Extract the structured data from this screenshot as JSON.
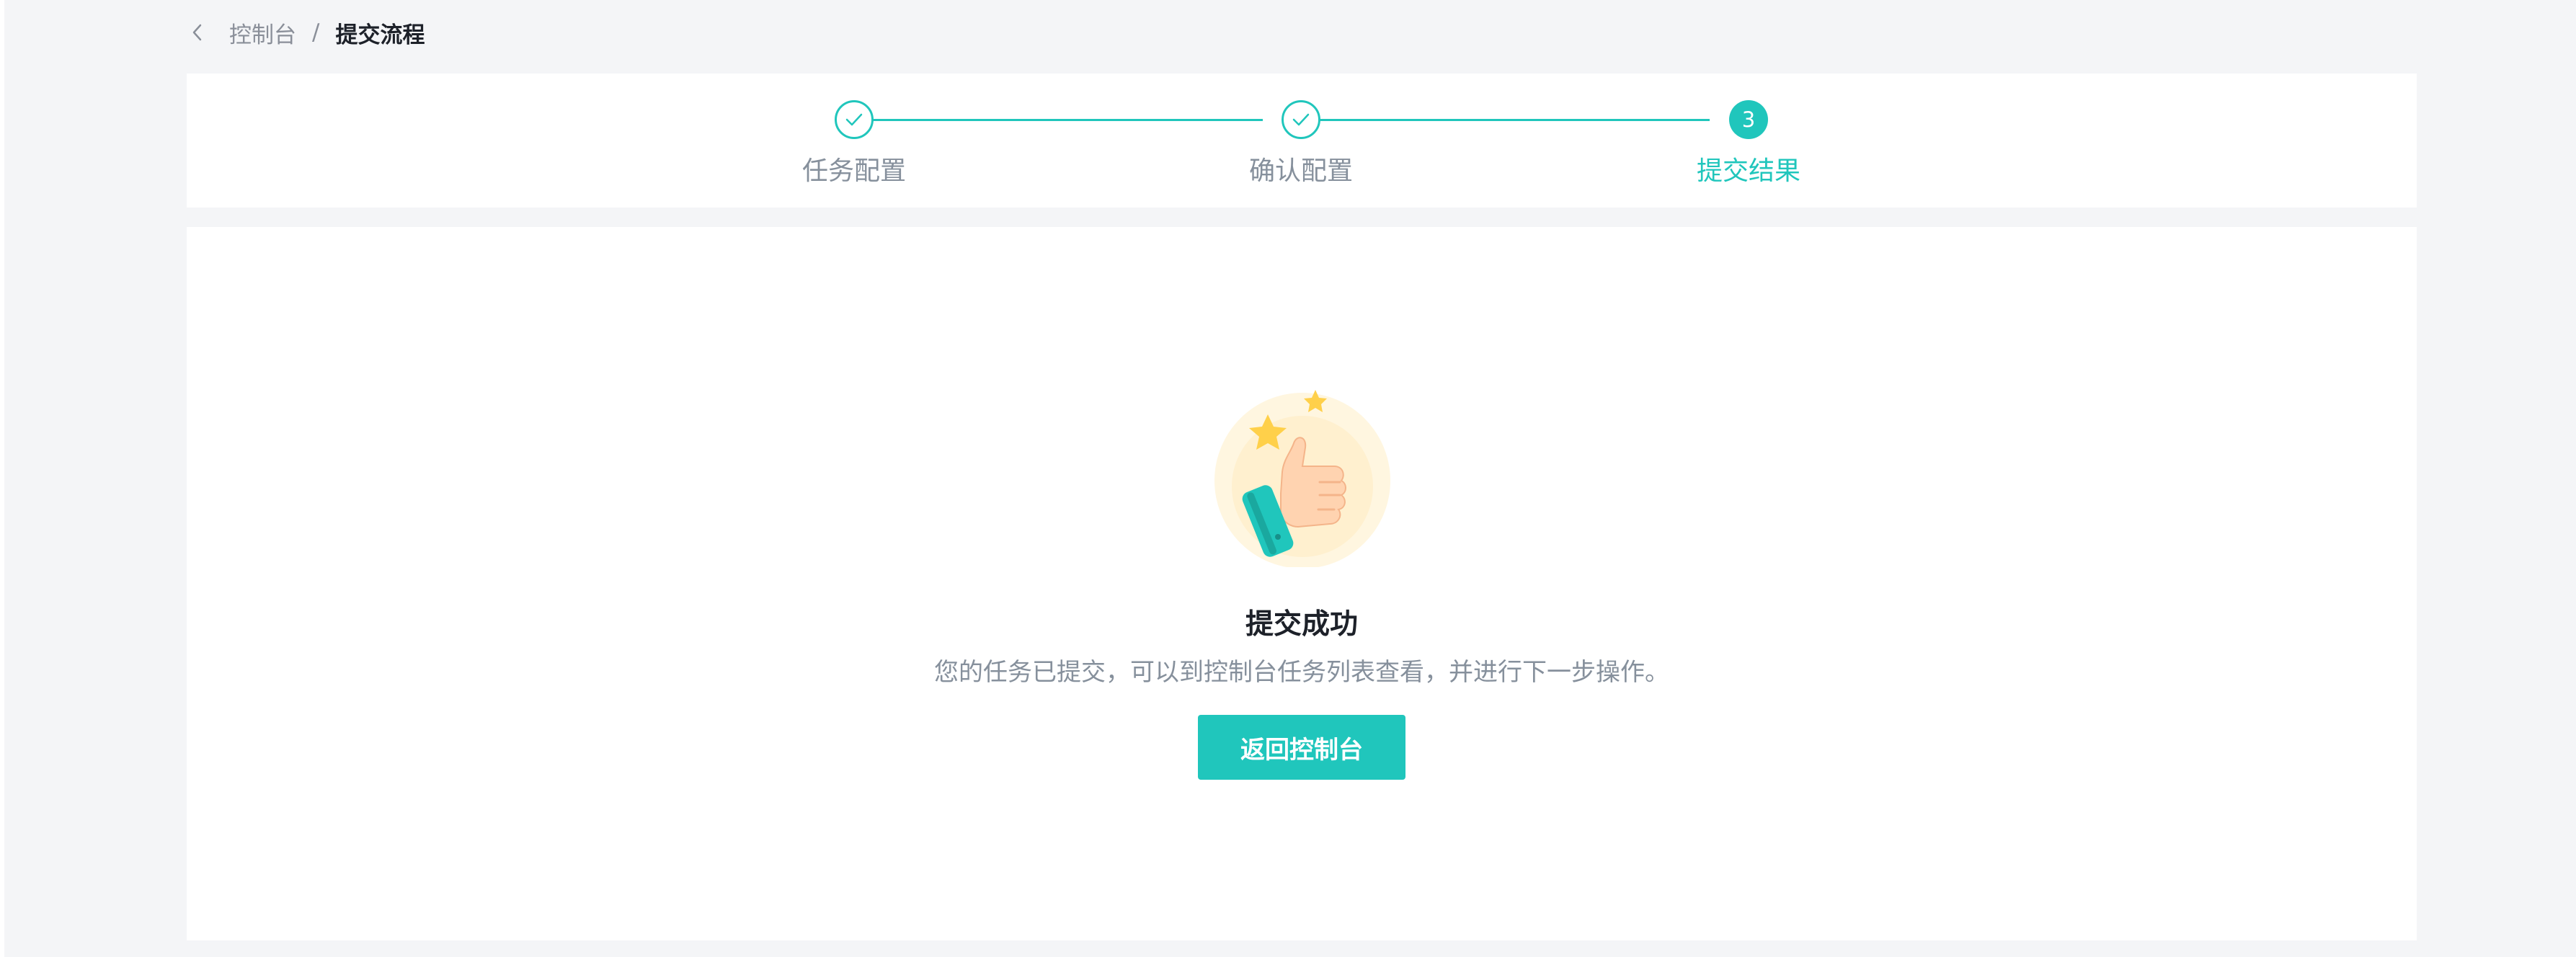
{
  "breadcrumb": {
    "back_icon": "chevron-left-icon",
    "parent": "控制台",
    "separator": "/",
    "current": "提交流程"
  },
  "steps": [
    {
      "label": "任务配置",
      "status": "done",
      "icon": "check-icon"
    },
    {
      "label": "确认配置",
      "status": "done",
      "icon": "check-icon"
    },
    {
      "label": "提交结果",
      "status": "active",
      "number": "3"
    }
  ],
  "result": {
    "illustration": "thumbs-up-illustration",
    "title": "提交成功",
    "description": "您的任务已提交，可以到控制台任务列表查看，并进行下一步操作。",
    "button_label": "返回控制台"
  },
  "colors": {
    "accent": "#20c6bc",
    "background": "#f4f5f7",
    "text_primary": "#1d2129",
    "text_secondary": "#86909c"
  }
}
